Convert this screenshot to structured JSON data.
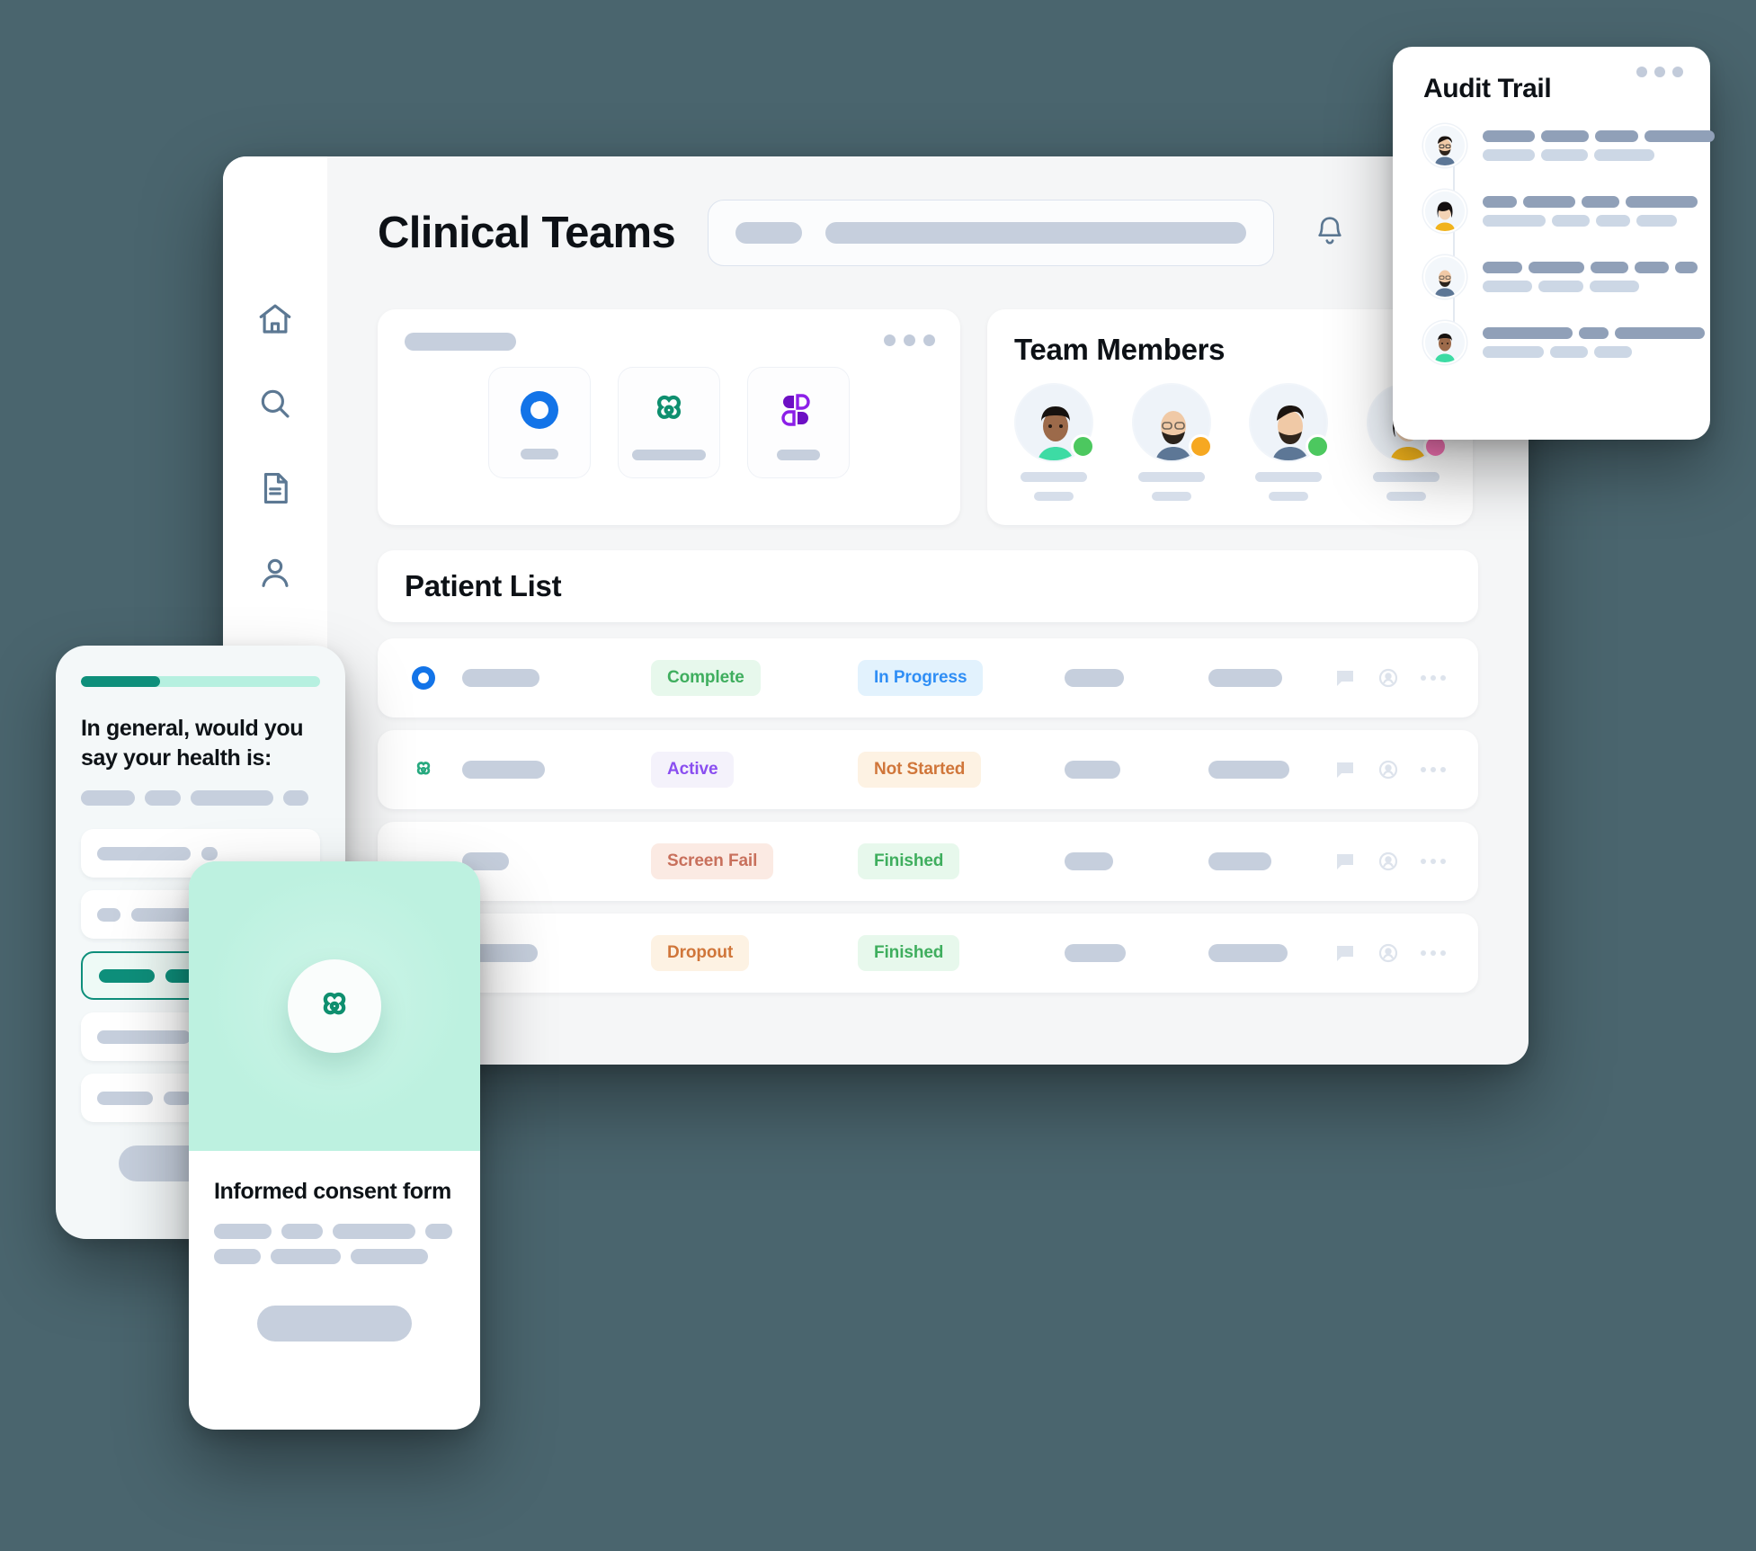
{
  "background_color": "#4a656e",
  "app": {
    "title": "Clinical Teams",
    "search": {
      "placeholder": ""
    },
    "sidebar": {
      "items": [
        {
          "icon": "home-icon",
          "label": "Home"
        },
        {
          "icon": "search-icon",
          "label": "Search"
        },
        {
          "icon": "document-icon",
          "label": "Documents"
        },
        {
          "icon": "user-icon",
          "label": "Profile"
        }
      ]
    },
    "apps_card": {
      "menu_icon": "ellipsis-icon",
      "tiles": [
        {
          "icon": "blue-ring-icon",
          "color": "#1374e8",
          "sk_width": 42
        },
        {
          "icon": "green-flower-icon",
          "color": "#0e8f6f",
          "sk_width": 82
        },
        {
          "icon": "purple-petal-icon",
          "color": "#7a14dd",
          "sk_width": 48
        }
      ]
    },
    "team_card": {
      "title": "Team Members",
      "members": [
        {
          "avatar": "avatar-woman-dark",
          "status_color": "#4cc85f",
          "status": "online"
        },
        {
          "avatar": "avatar-bald-beard",
          "status_color": "#f6a821",
          "status": "away"
        },
        {
          "avatar": "avatar-man-beard",
          "status_color": "#4cc85f",
          "status": "online"
        },
        {
          "avatar": "avatar-woman-bob",
          "status_color": "#f875b7",
          "status": "busy"
        }
      ]
    },
    "patient_list": {
      "title": "Patient List",
      "rows": [
        {
          "icon": "blue-ring-icon",
          "icon_color": "#1374e8",
          "name_sk": 86,
          "badge1": {
            "text": "Complete",
            "fg": "#3fae5e",
            "bg": "#e7f8ec"
          },
          "badge2": {
            "text": "In Progress",
            "fg": "#2f8ef5",
            "bg": "#e2f2fd"
          },
          "f1_sk": 66,
          "f2_sk": 82,
          "actions": [
            "comment-icon",
            "assignee-icon",
            "ellipsis-icon"
          ]
        },
        {
          "icon": "green-flower-icon",
          "icon_color": "#0e8f6f",
          "name_sk": 92,
          "badge1": {
            "text": "Active",
            "fg": "#8a4ef0",
            "bg": "#f4f2fb"
          },
          "badge2": {
            "text": "Not Started",
            "fg": "#d0763a",
            "bg": "#fdf2e3"
          },
          "f1_sk": 62,
          "f2_sk": 90,
          "actions": [
            "comment-icon",
            "assignee-icon",
            "ellipsis-icon"
          ]
        },
        {
          "icon": "",
          "icon_color": "",
          "name_sk": 52,
          "badge1": {
            "text": "Screen Fail",
            "fg": "#c8705c",
            "bg": "#fbeae3"
          },
          "badge2": {
            "text": "Finished",
            "fg": "#3fae5e",
            "bg": "#e7f8ec"
          },
          "f1_sk": 54,
          "f2_sk": 70,
          "actions": [
            "comment-icon",
            "assignee-icon",
            "ellipsis-icon"
          ]
        },
        {
          "icon": "",
          "icon_color": "",
          "name_sk": 84,
          "badge1": {
            "text": "Dropout",
            "fg": "#d0763a",
            "bg": "#fdf2e3"
          },
          "badge2": {
            "text": "Finished",
            "fg": "#3fae5e",
            "bg": "#e7f8ec"
          },
          "f1_sk": 68,
          "f2_sk": 88,
          "actions": [
            "comment-icon",
            "assignee-icon",
            "ellipsis-icon"
          ]
        }
      ]
    }
  },
  "audit_trail": {
    "title": "Audit Trail",
    "menu_icon": "ellipsis-icon",
    "entries": [
      {
        "avatar": "avatar-man-glasses-beard",
        "top_widths": [
          58,
          53,
          48,
          78
        ],
        "bottom_widths": [
          58,
          52,
          67
        ]
      },
      {
        "avatar": "avatar-woman-yellow",
        "top_widths": [
          38,
          58,
          42,
          80
        ],
        "bottom_widths": [
          70,
          42,
          38,
          45
        ]
      },
      {
        "avatar": "avatar-bald-beard",
        "top_widths": [
          44,
          62,
          42,
          38,
          25
        ],
        "bottom_widths": [
          55,
          50,
          55
        ]
      },
      {
        "avatar": "avatar-man-teal",
        "top_widths": [
          100,
          33,
          100
        ],
        "bottom_widths": [
          68,
          42,
          42
        ]
      }
    ]
  },
  "survey_phone": {
    "progress_percent": 33,
    "question": "In general, would you say your health is:",
    "question_sk_widths": [
      60,
      40,
      92,
      28
    ],
    "options": [
      {
        "selected": false,
        "bars": [
          104,
          18
        ]
      },
      {
        "selected": false,
        "bars": [
          26,
          76
        ]
      },
      {
        "selected": true,
        "bars": [
          62,
          56
        ]
      },
      {
        "selected": false,
        "bars": [
          104
        ]
      },
      {
        "selected": false,
        "bars": [
          62,
          32
        ]
      }
    ],
    "submit_sk": true
  },
  "consent_phone": {
    "hero_icon": "green-flower-icon",
    "hero_color": "#0e8f6f",
    "hero_bg": "#bdf1e0",
    "title": "Informed consent form",
    "body_lines": [
      [
        64,
        46,
        92,
        30
      ],
      [
        52,
        78,
        86
      ]
    ],
    "button_sk": true
  }
}
